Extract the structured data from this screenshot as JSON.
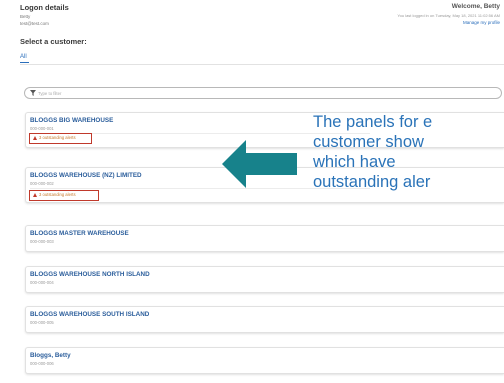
{
  "header": {
    "logon_title": "Logon details",
    "user_name": "Betty",
    "user_email": "test@test.com",
    "welcome": "Welcome, Betty",
    "last_login": "You last logged in on Tuesday, May 18, 2021 11:02:56 AM",
    "manage_profile": "Manage my profile"
  },
  "select_title": "Select a customer:",
  "tabs": [
    {
      "label": "All",
      "active": true
    }
  ],
  "filter": {
    "placeholder": "Type to filter"
  },
  "customers": [
    {
      "name": "BLOGGS BIG WAREHOUSE",
      "code": "000-000-001",
      "alert": "3 outstanding alerts"
    },
    {
      "name": "BLOGGS WAREHOUSE (NZ) LIMITED",
      "code": "000-000-002",
      "alert": "3 outstanding alerts"
    },
    {
      "name": "BLOGGS MASTER WAREHOUSE",
      "code": "000-000-003"
    },
    {
      "name": "BLOGGS WAREHOUSE NORTH ISLAND",
      "code": "000-000-004"
    },
    {
      "name": "BLOGGS WAREHOUSE SOUTH ISLAND",
      "code": "000-000-005"
    },
    {
      "name": "Bloggs, Betty",
      "code": "000-000-006"
    }
  ],
  "annotation": {
    "text": "The panels for e\ncustomer show\nwhich have\noutstanding aler",
    "color": "#2a73b8",
    "arrow_color": "#17828b",
    "highlight_color": "#c0392b"
  }
}
